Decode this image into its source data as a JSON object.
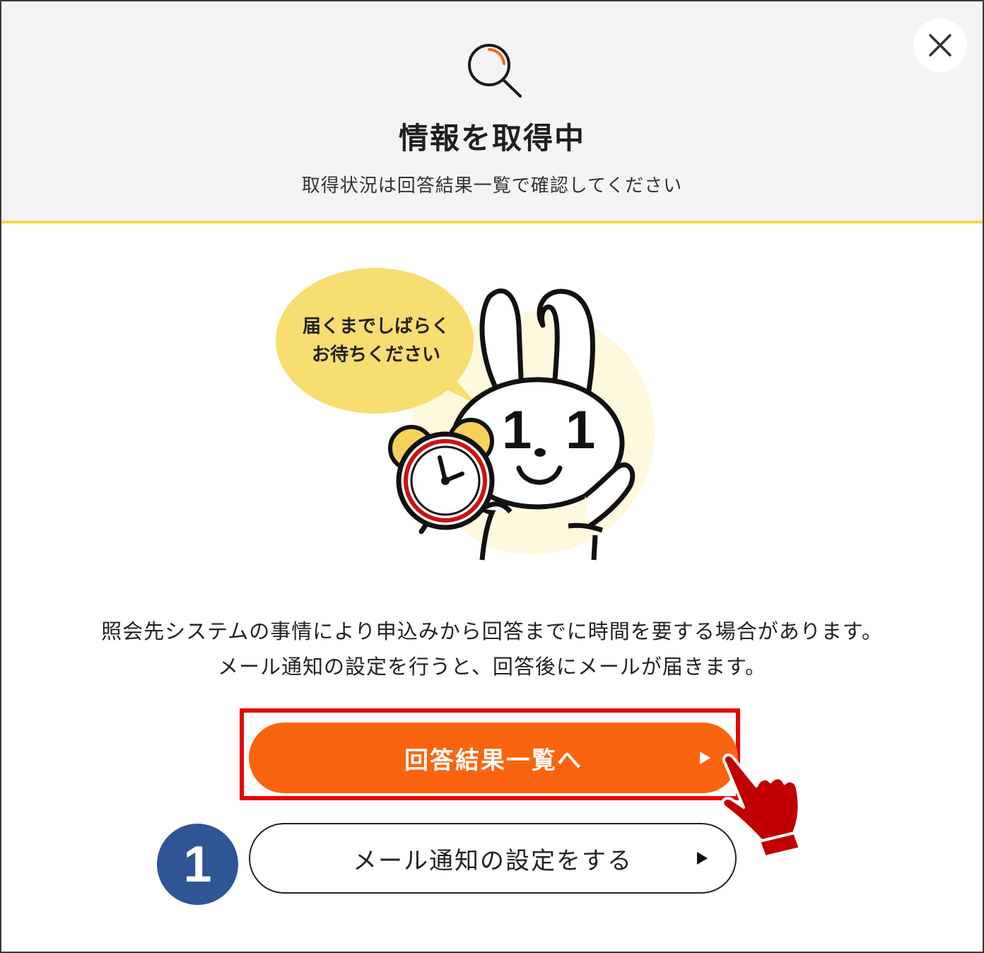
{
  "header": {
    "title": "情報を取得中",
    "subtitle": "取得状況は回答結果一覧で確認してください"
  },
  "illustration": {
    "bubble_line1": "届くまでしばらく",
    "bubble_line2": "お待ちください",
    "face_marks": [
      "1",
      "1"
    ]
  },
  "message": {
    "line1": "照会先システムの事情により申込みから回答までに時間を要する場合があります。",
    "line2": "メール通知の設定を行うと、回答後にメールが届きます。"
  },
  "buttons": {
    "primary_label": "回答結果一覧へ",
    "secondary_label": "メール通知の設定をする"
  },
  "annotation": {
    "step_number": "1"
  },
  "colors": {
    "accent_orange": "#fb640e",
    "header_border": "#f7d84a",
    "highlight_red": "#e60000",
    "step_badge": "#2f5597"
  },
  "icons": [
    "search-icon",
    "close-icon",
    "play-arrow-icon",
    "hand-pointer-icon"
  ]
}
